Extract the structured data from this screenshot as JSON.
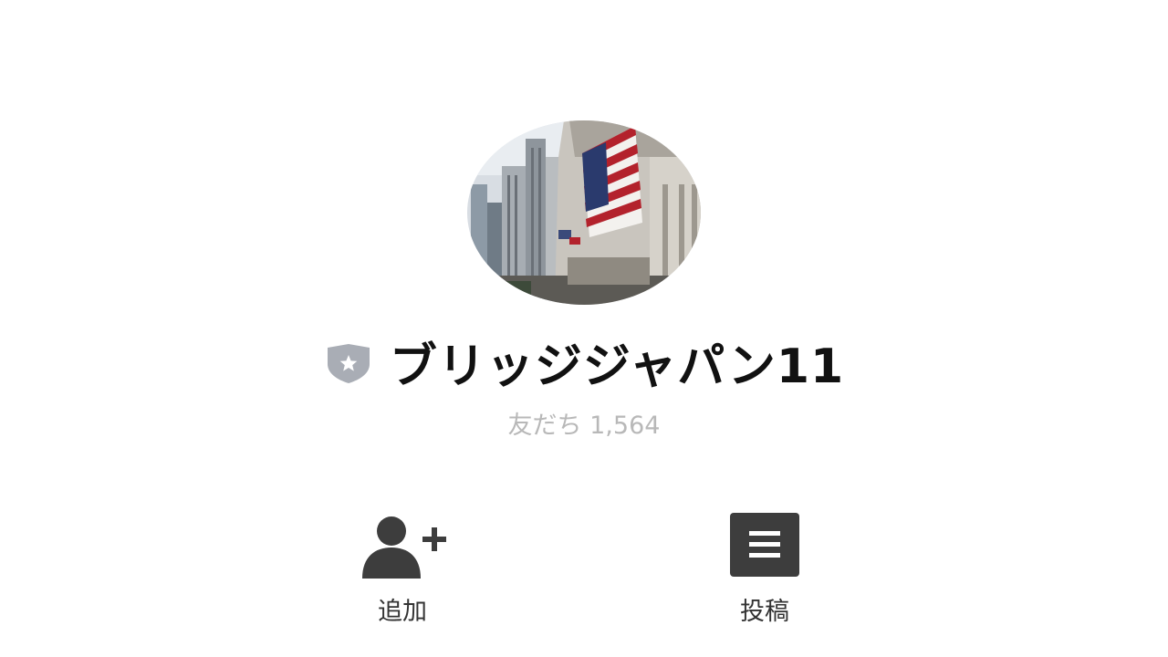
{
  "profile": {
    "name": "ブリッジジャパン11",
    "friends_label": "友だち 1,564"
  },
  "actions": [
    {
      "label": "追加",
      "icon": "add-friend-icon"
    },
    {
      "label": "投稿",
      "icon": "posts-icon"
    }
  ],
  "badge": {
    "icon": "shield-star-icon",
    "color": "#a9adb5"
  }
}
